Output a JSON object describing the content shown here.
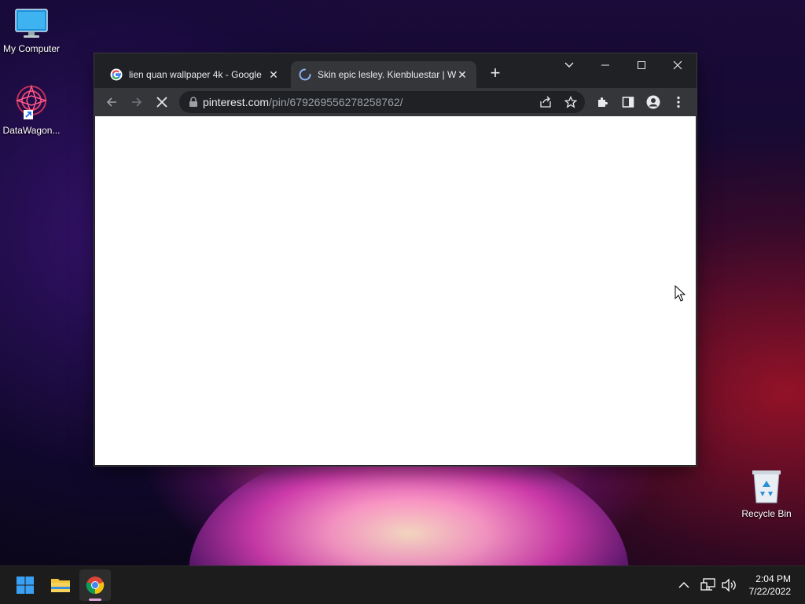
{
  "desktop": {
    "icons": [
      {
        "label": "My Computer"
      },
      {
        "label": "DataWagon..."
      },
      {
        "label": "Recycle Bin"
      }
    ]
  },
  "browser": {
    "tabs": [
      {
        "title": "lien quan wallpaper 4k - Google",
        "icon": "google-icon"
      },
      {
        "title": "Skin epic lesley. Kienbluestar | W",
        "icon": "loading-spinner-icon"
      }
    ],
    "url_host": "pinterest.com",
    "url_path": "/pin/679269556278258762/"
  },
  "taskbar": {
    "time": "2:04 PM",
    "date": "7/22/2022"
  },
  "colors": {
    "chrome_dark": "#202124",
    "chrome_toolbar": "#35363a",
    "taskbar": "#1c1c1c"
  }
}
